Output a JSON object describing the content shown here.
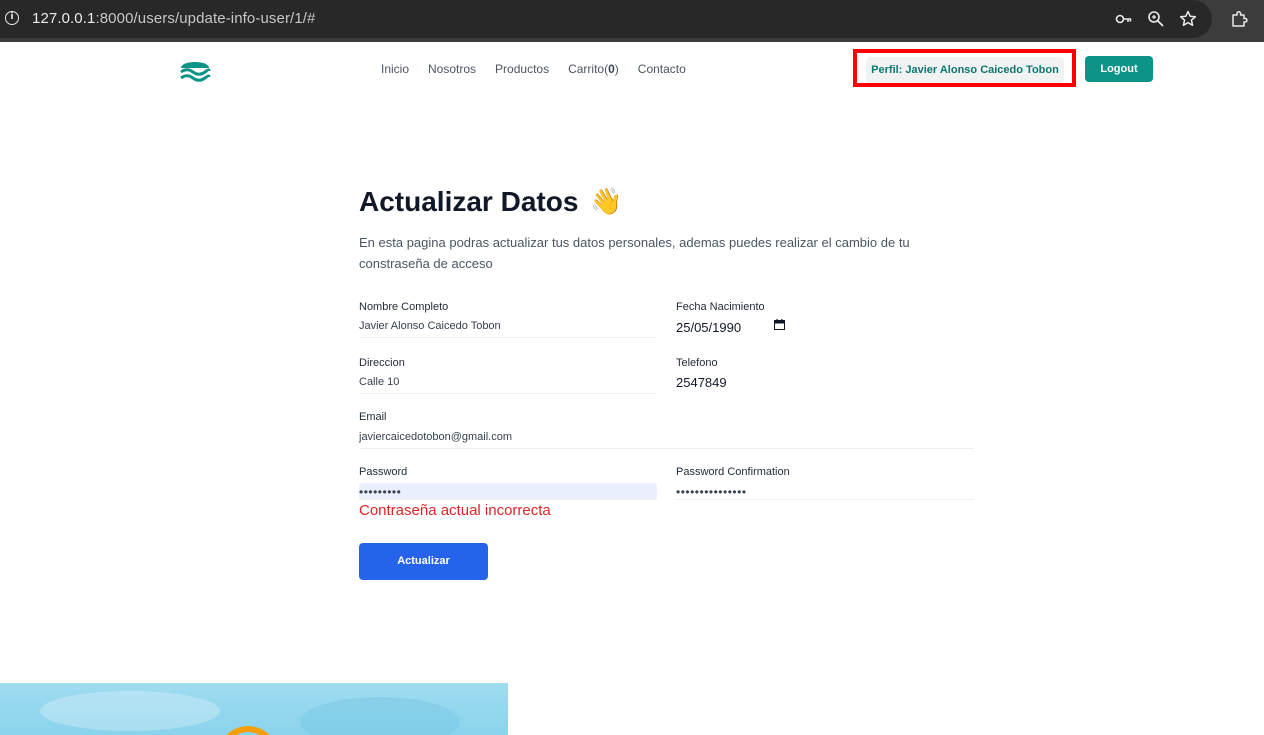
{
  "browser": {
    "url_host": "127.0.0.1",
    "url_rest": ":8000/users/update-info-user/1/#",
    "icons": [
      "info-icon",
      "key-icon",
      "zoom-icon",
      "star-icon",
      "extensions-icon"
    ]
  },
  "nav": {
    "items": [
      {
        "label": "Inicio"
      },
      {
        "label": "Nosotros"
      },
      {
        "label": "Productos"
      },
      {
        "label": "Carrito(",
        "count": "0",
        "suffix": ")"
      },
      {
        "label": "Contacto"
      }
    ],
    "profile_label": "Perfil: Javier Alonso Caicedo Tobon",
    "logout_label": "Logout"
  },
  "page": {
    "title": "Actualizar Datos",
    "title_emoji": "👋",
    "description": "En esta pagina podras actualizar tus datos personales, ademas puedes realizar el cambio de tu constraseña de acceso"
  },
  "form": {
    "nombre": {
      "label": "Nombre Completo",
      "value": "Javier Alonso Caicedo Tobon"
    },
    "fecha": {
      "label": "Fecha Nacimiento",
      "value": "25/05/1990"
    },
    "direccion": {
      "label": "Direccion",
      "value": "Calle 10"
    },
    "telefono": {
      "label": "Telefono",
      "value": "2547849"
    },
    "email": {
      "label": "Email",
      "value": "javiercaicedotobon@gmail.com"
    },
    "password": {
      "label": "Password",
      "value": "•••••••••"
    },
    "password_confirmation": {
      "label": "Password Confirmation",
      "value": "•••••••••••••••"
    },
    "error": "Contraseña actual incorrecta",
    "submit_label": "Actualizar"
  },
  "colors": {
    "brand_teal": "#0d9488",
    "primary_blue": "#2563eb",
    "error_red": "#dc2626",
    "highlight_red": "#ff0000"
  }
}
